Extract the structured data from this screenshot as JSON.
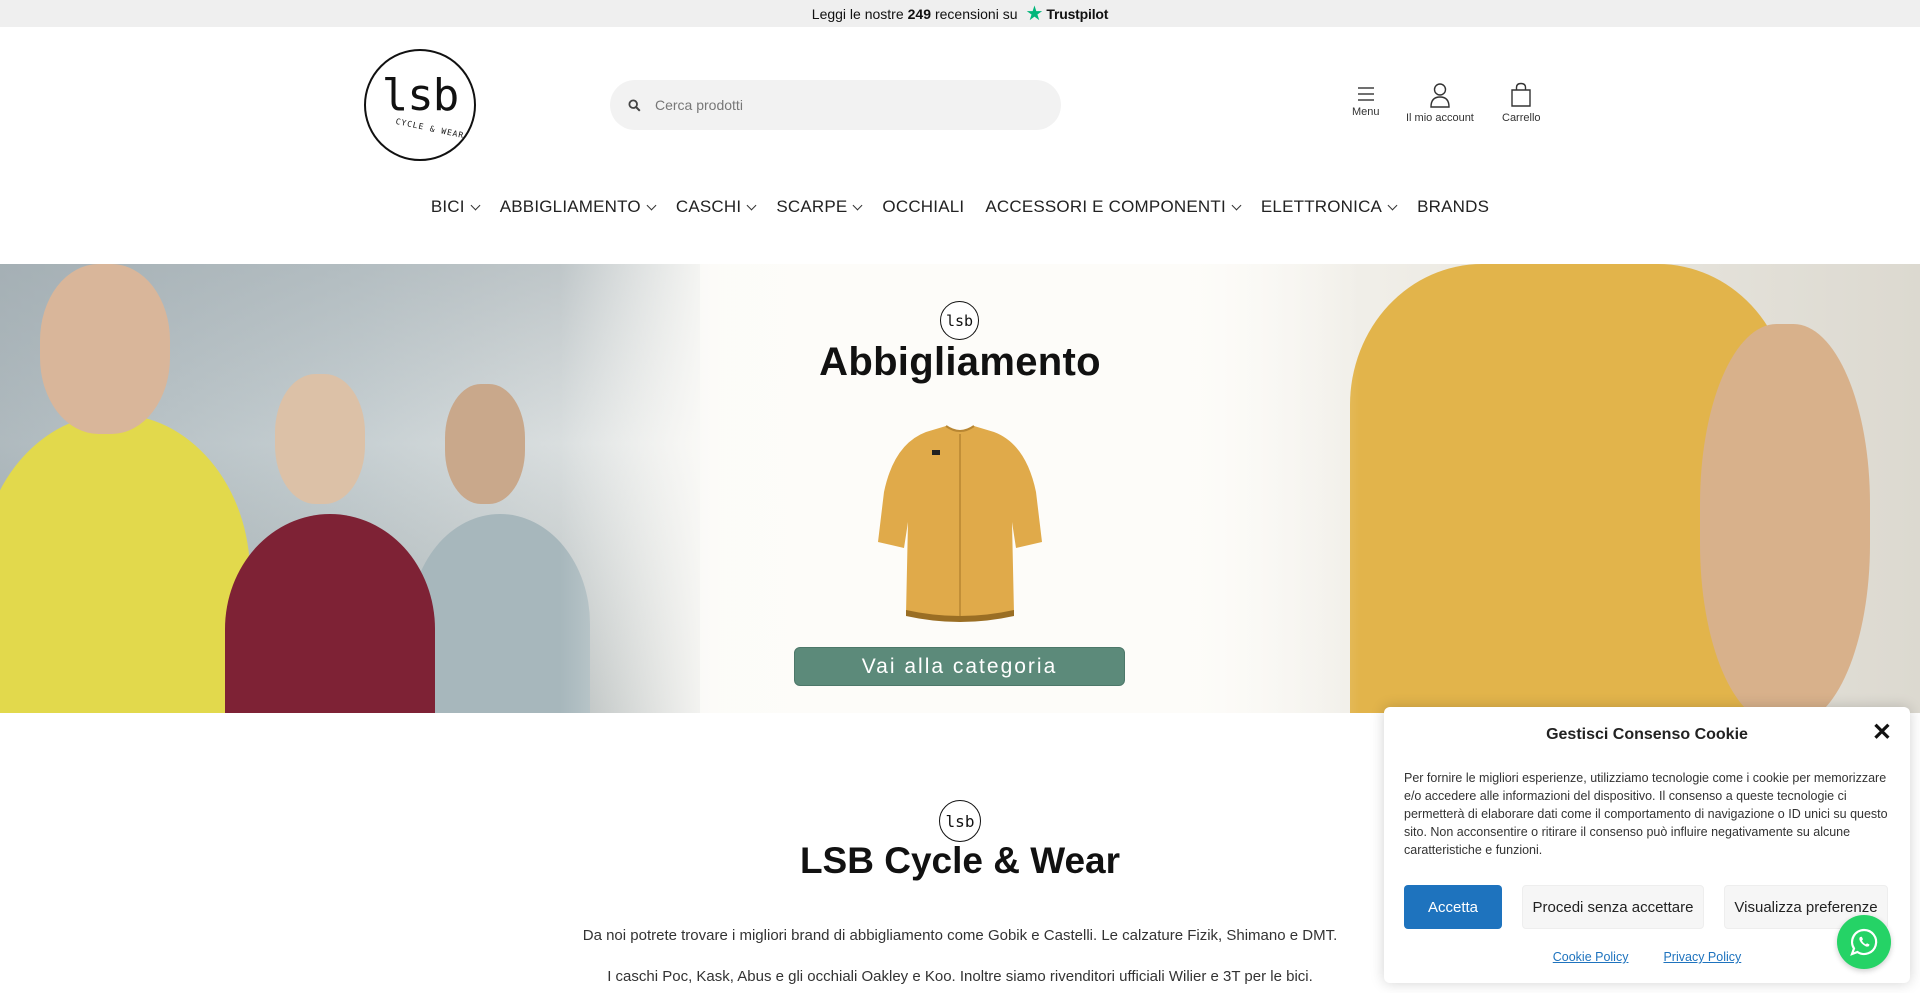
{
  "topbar": {
    "prefix": "Leggi le nostre",
    "count": "249",
    "suffix": "recensioni su",
    "brand": "Trustpilot"
  },
  "logo": {
    "main": "lsb",
    "sub": "CYCLE & WEAR"
  },
  "search": {
    "placeholder": "Cerca prodotti",
    "value": ""
  },
  "header_icons": {
    "menu": "Menu",
    "account": "Il mio account",
    "cart": "Carrello"
  },
  "nav": [
    {
      "label": "BICI",
      "dropdown": true
    },
    {
      "label": "ABBIGLIAMENTO",
      "dropdown": true
    },
    {
      "label": "CASCHI",
      "dropdown": true
    },
    {
      "label": "SCARPE",
      "dropdown": true
    },
    {
      "label": "OCCHIALI",
      "dropdown": false
    },
    {
      "label": "ACCESSORI E COMPONENTI",
      "dropdown": true
    },
    {
      "label": "ELETTRONICA",
      "dropdown": true
    },
    {
      "label": "BRANDS",
      "dropdown": false
    }
  ],
  "hero": {
    "logo": "lsb",
    "title": "Abbigliamento",
    "button": "Vai alla categoria"
  },
  "about": {
    "logo": "lsb",
    "title": "LSB Cycle & Wear",
    "p1": "Da noi potrete trovare i migliori brand di abbigliamento come Gobik e Castelli. Le calzature Fizik, Shimano e DMT.",
    "p2": "I caschi Poc, Kask, Abus e gli occhiali Oakley e Koo. Inoltre siamo rivenditori ufficiali Wilier e 3T per le bici."
  },
  "cookie": {
    "title": "Gestisci Consenso Cookie",
    "text": "Per fornire le migliori esperienze, utilizziamo tecnologie come i cookie per memorizzare e/o accedere alle informazioni del dispositivo. Il consenso a queste tecnologie ci permetterà di elaborare dati come il comportamento di navigazione o ID unici su questo sito. Non acconsentire o ritirare il consenso può influire negativamente su alcune caratteristiche e funzioni.",
    "accept": "Accetta",
    "deny": "Procedi senza accettare",
    "prefs": "Visualizza preferenze",
    "link_cookie": "Cookie Policy",
    "link_privacy": "Privacy Policy"
  },
  "colors": {
    "accent_button": "#5c8a7a",
    "cookie_accept": "#1e73be",
    "trustpilot_star": "#00b67a",
    "whatsapp": "#25d366"
  },
  "icons": [
    "search-icon",
    "menu-icon",
    "user-icon",
    "bag-icon",
    "chevron-down-icon",
    "close-icon",
    "whatsapp-icon",
    "star-icon"
  ]
}
